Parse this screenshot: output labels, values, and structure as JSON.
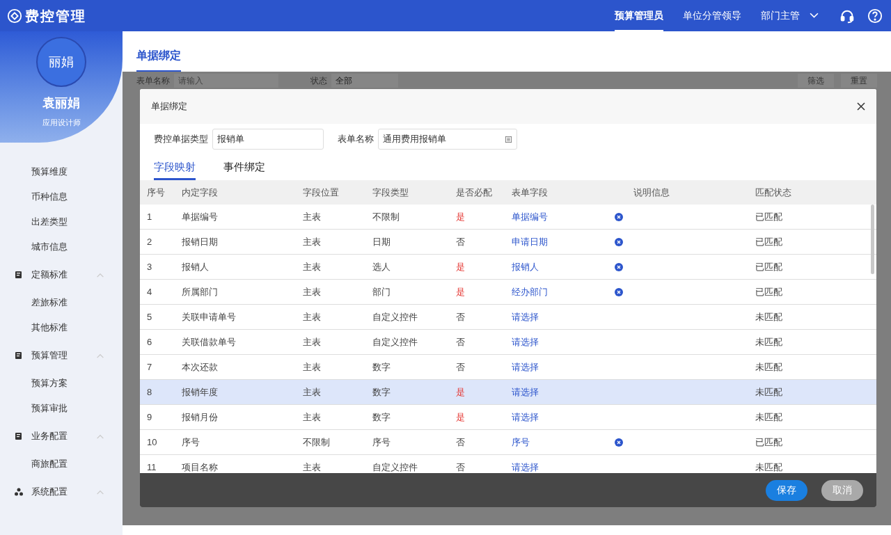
{
  "app": {
    "title": "费控管理"
  },
  "roles": [
    {
      "label": "预算管理员",
      "selected": true
    },
    {
      "label": "单位分管领导",
      "selected": false
    },
    {
      "label": "部门主管",
      "selected": false
    }
  ],
  "user": {
    "avatar_text": "丽娟",
    "name": "袁丽娟",
    "role": "应用设计师"
  },
  "sidebar": {
    "items": [
      {
        "kind": "item",
        "label": "预算维度"
      },
      {
        "kind": "item",
        "label": "币种信息"
      },
      {
        "kind": "item",
        "label": "出差类型"
      },
      {
        "kind": "item",
        "label": "城市信息"
      },
      {
        "kind": "group",
        "label": "定额标准",
        "expanded": true,
        "children": [
          {
            "label": "差旅标准"
          },
          {
            "label": "其他标准"
          }
        ]
      },
      {
        "kind": "group",
        "label": "预算管理",
        "expanded": true,
        "children": [
          {
            "label": "预算方案"
          },
          {
            "label": "预算审批"
          }
        ]
      },
      {
        "kind": "group",
        "label": "业务配置",
        "expanded": true,
        "children": [
          {
            "label": "商旅配置"
          }
        ]
      },
      {
        "kind": "group",
        "label": "系统配置",
        "expanded": true
      }
    ]
  },
  "page_tab": {
    "label": "单据绑定"
  },
  "filter_bar": {
    "fields": [
      {
        "label": "表单名称",
        "placeholder": "请输入"
      },
      {
        "label": "状态",
        "value": "全部"
      }
    ],
    "buttons": [
      "筛选",
      "重置"
    ]
  },
  "dialog": {
    "title": "单据绑定",
    "fields": [
      {
        "label": "费控单据类型",
        "value": "报销单",
        "kind": "text"
      },
      {
        "label": "表单名称",
        "value": "通用费用报销单",
        "kind": "picker"
      }
    ],
    "tabs": [
      {
        "label": "字段映射",
        "selected": true
      },
      {
        "label": "事件绑定",
        "selected": false
      }
    ],
    "table": {
      "columns": [
        "序号",
        "内定字段",
        "字段位置",
        "字段类型",
        "是否必配",
        "表单字段",
        "说明信息",
        "匹配状态"
      ],
      "rows": [
        {
          "no": "1",
          "field": "单据编号",
          "position": "主表",
          "type": "不限制",
          "required_text": "是",
          "required": true,
          "form_field": "单据编号",
          "clearable": true,
          "status": "已匹配",
          "highlighted": false
        },
        {
          "no": "2",
          "field": "报销日期",
          "position": "主表",
          "type": "日期",
          "required_text": "否",
          "required": false,
          "form_field": "申请日期",
          "clearable": true,
          "status": "已匹配",
          "highlighted": false
        },
        {
          "no": "3",
          "field": "报销人",
          "position": "主表",
          "type": "选人",
          "required_text": "是",
          "required": true,
          "form_field": "报销人",
          "clearable": true,
          "status": "已匹配",
          "highlighted": false
        },
        {
          "no": "4",
          "field": "所属部门",
          "position": "主表",
          "type": "部门",
          "required_text": "是",
          "required": true,
          "form_field": "经办部门",
          "clearable": true,
          "status": "已匹配",
          "highlighted": false
        },
        {
          "no": "5",
          "field": "关联申请单号",
          "position": "主表",
          "type": "自定义控件",
          "required_text": "否",
          "required": false,
          "form_field": "请选择",
          "clearable": false,
          "status": "未匹配",
          "highlighted": false
        },
        {
          "no": "6",
          "field": "关联借款单号",
          "position": "主表",
          "type": "自定义控件",
          "required_text": "否",
          "required": false,
          "form_field": "请选择",
          "clearable": false,
          "status": "未匹配",
          "highlighted": false
        },
        {
          "no": "7",
          "field": "本次还款",
          "position": "主表",
          "type": "数字",
          "required_text": "否",
          "required": false,
          "form_field": "请选择",
          "clearable": false,
          "status": "未匹配",
          "highlighted": false
        },
        {
          "no": "8",
          "field": "报销年度",
          "position": "主表",
          "type": "数字",
          "required_text": "是",
          "required": true,
          "form_field": "请选择",
          "clearable": false,
          "status": "未匹配",
          "highlighted": true
        },
        {
          "no": "9",
          "field": "报销月份",
          "position": "主表",
          "type": "数字",
          "required_text": "是",
          "required": true,
          "form_field": "请选择",
          "clearable": false,
          "status": "未匹配",
          "highlighted": false
        },
        {
          "no": "10",
          "field": "序号",
          "position": "不限制",
          "type": "序号",
          "required_text": "否",
          "required": false,
          "form_field": "序号",
          "clearable": true,
          "status": "已匹配",
          "highlighted": false
        },
        {
          "no": "11",
          "field": "项目名称",
          "position": "主表",
          "type": "自定义控件",
          "required_text": "否",
          "required": false,
          "form_field": "请选择",
          "clearable": false,
          "status": "未匹配",
          "highlighted": false
        }
      ]
    },
    "buttons": [
      {
        "label": "保存",
        "kind": "primary"
      },
      {
        "label": "取消",
        "kind": "secondary"
      }
    ]
  }
}
